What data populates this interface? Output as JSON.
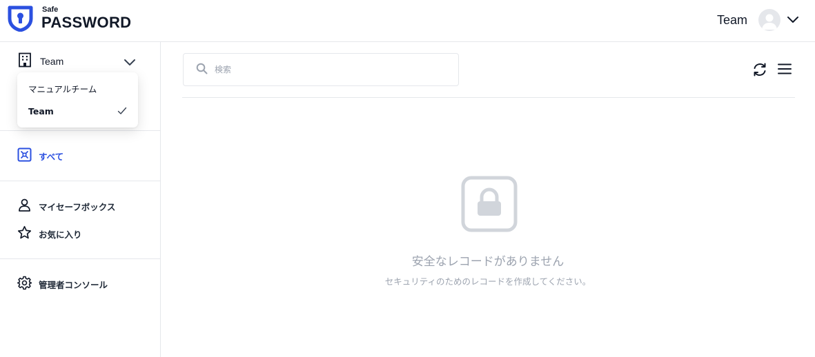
{
  "app": {
    "logo_small": "Safe",
    "logo_large": "PASSWORD",
    "brand_color": "#2b50e0"
  },
  "header": {
    "team_label": "Team",
    "avatar_icon": "user-avatar-icon",
    "chevron_icon": "chevron-down-icon"
  },
  "sidebar": {
    "org_select": {
      "label": "Team",
      "icon": "building-icon"
    },
    "dropdown": {
      "items": [
        {
          "label": "マニュアルチーム",
          "selected": false
        },
        {
          "label": "Team",
          "selected": true
        }
      ]
    },
    "nav": {
      "all": {
        "label": "すべて",
        "icon": "vault-icon",
        "active": true
      },
      "my_safebox": {
        "label": "マイセーフボックス",
        "icon": "user-icon"
      },
      "favorites": {
        "label": "お気に入り",
        "icon": "star-icon"
      },
      "admin_console": {
        "label": "管理者コンソール",
        "icon": "gear-icon"
      }
    }
  },
  "main": {
    "search": {
      "placeholder": "検索",
      "value": ""
    },
    "empty_state": {
      "icon": "lock-icon",
      "title": "安全なレコードがありません",
      "subtitle": "セキュリティのためのレコードを作成してください。"
    }
  }
}
